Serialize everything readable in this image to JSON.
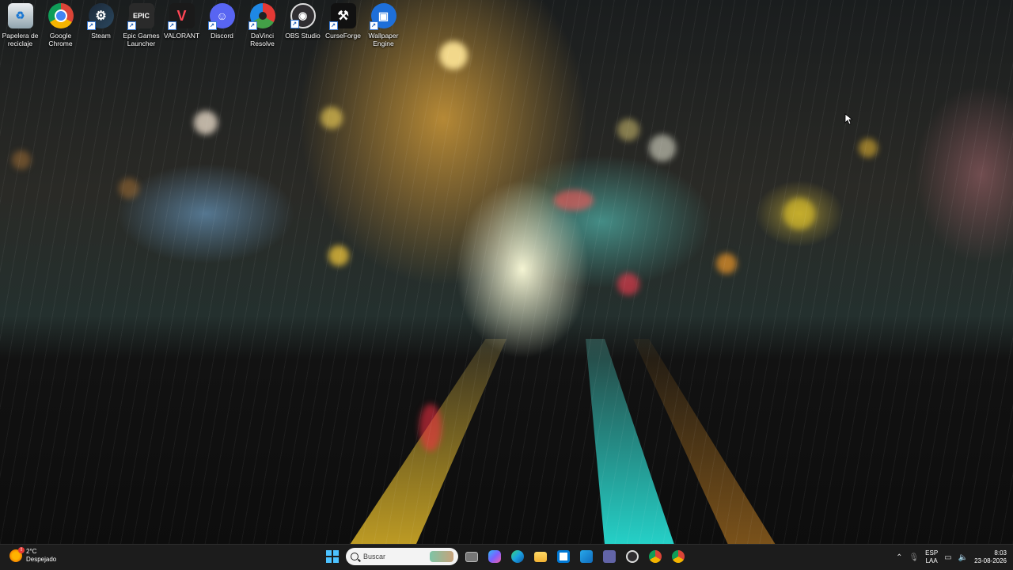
{
  "desktop": {
    "icons": [
      {
        "label": "Papelera de\nreciclaje",
        "icon": "recycle-bin-icon",
        "color": "#cfd8dc"
      },
      {
        "label": "Google\nChrome",
        "icon": "chrome-icon",
        "color": "#db4437"
      },
      {
        "label": "Steam",
        "icon": "steam-icon",
        "color": "#1b2838"
      },
      {
        "label": "Epic Games\nLauncher",
        "icon": "epic-games-icon",
        "color": "#2a2a2a"
      },
      {
        "label": "VALORANT",
        "icon": "valorant-icon",
        "color": "#ff4655"
      },
      {
        "label": "Discord",
        "icon": "discord-icon",
        "color": "#5865f2"
      },
      {
        "label": "DaVinci\nResolve",
        "icon": "davinci-resolve-icon",
        "color": "#2b2b2b"
      },
      {
        "label": "OBS Studio",
        "icon": "obs-icon",
        "color": "#302e31"
      },
      {
        "label": "CurseForge",
        "icon": "curseforge-icon",
        "color": "#111111"
      },
      {
        "label": "Wallpaper\nEngine",
        "icon": "wallpaper-engine-icon",
        "color": "#1e6fd9"
      }
    ]
  },
  "taskbar": {
    "weather": {
      "temp": "2°C",
      "condition": "Despejado",
      "badge": "!"
    },
    "search": {
      "placeholder": "Buscar"
    },
    "apps": [
      {
        "name": "task-view-icon",
        "color": "#9e9e9e"
      },
      {
        "name": "copilot-icon",
        "color": "#7b61ff"
      },
      {
        "name": "edge-icon",
        "color": "#1ba1e2"
      },
      {
        "name": "file-explorer-icon",
        "color": "#f6c344"
      },
      {
        "name": "store-icon",
        "color": "#0078d4"
      },
      {
        "name": "outlook-icon",
        "color": "#0f6cbd"
      },
      {
        "name": "teams-icon",
        "color": "#6264a7"
      },
      {
        "name": "obs-taskbar-icon",
        "color": "#302e31"
      },
      {
        "name": "chrome-taskbar-icon",
        "color": "#db4437"
      },
      {
        "name": "chrome-profile-taskbar-icon",
        "color": "#f4b400"
      }
    ],
    "tray": {
      "lang_top": "ESP",
      "lang_bottom": "LAA",
      "time": "8:03",
      "date": "23-08-2026"
    }
  }
}
